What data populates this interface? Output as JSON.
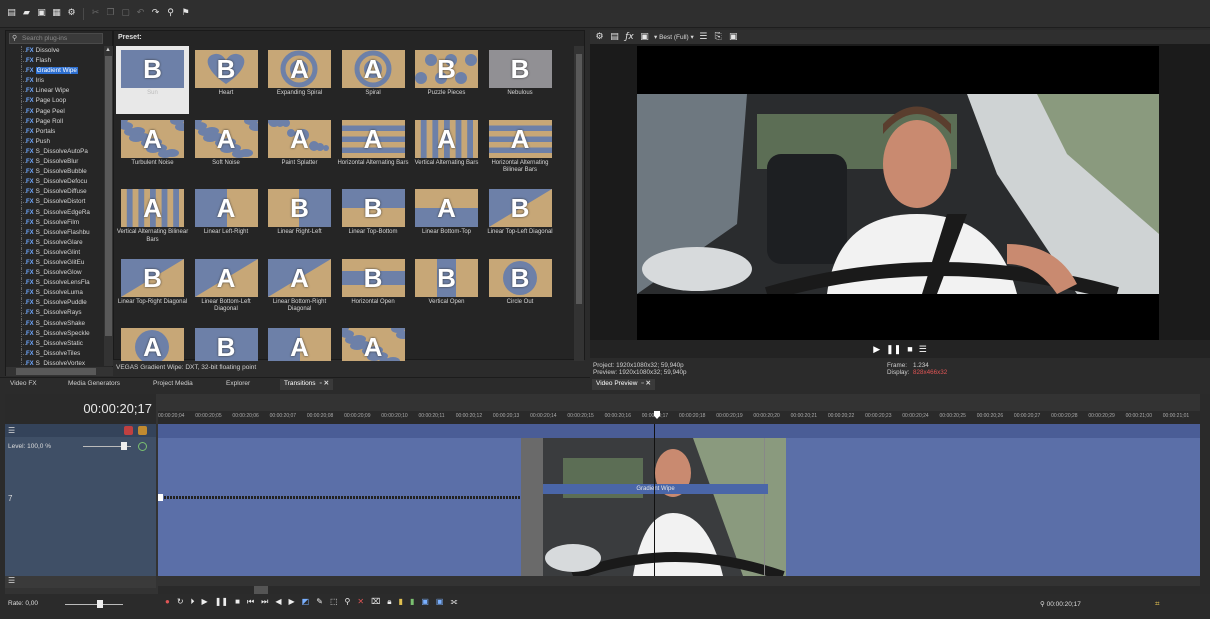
{
  "toolbar": {
    "icons": [
      "new-icon",
      "open-icon",
      "save-icon",
      "properties-icon",
      "settings-icon",
      "cut-icon",
      "copy-icon",
      "paste-icon",
      "undo-icon",
      "redo-icon",
      "snap-icon",
      "autoripple-icon"
    ]
  },
  "plugins": {
    "search_placeholder": "Search plug-ins",
    "fx_prefix": "FX",
    "items": [
      "Dissolve",
      "Flash",
      "Gradient Wipe",
      "Iris",
      "Linear Wipe",
      "Page Loop",
      "Page Peel",
      "Page Roll",
      "Portals",
      "Push",
      "S_DissolveAutoPa",
      "S_DissolveBlur",
      "S_DissolveBubble",
      "S_DissolveDefocu",
      "S_DissolveDiffuse",
      "S_DissolveDistort",
      "S_DissolveEdgeRa",
      "S_DissolveFilm",
      "S_DissolveFlashbu",
      "S_DissolveGlare",
      "S_DissolveGlint",
      "S_DissolveGlitEu",
      "S_DissolveGlow",
      "S_DissolveLensFla",
      "S_DissolveLuma",
      "S_DissolvePuddle",
      "S_DissolveRays",
      "S_DissolveShake",
      "S_DissolveSpeckle",
      "S_DissolveStatic",
      "S_DissolveTiles",
      "S_DissolveVortex"
    ],
    "selected_index": 2
  },
  "presets": {
    "label": "Preset:",
    "items": [
      {
        "name": "Sun",
        "glyph": "B"
      },
      {
        "name": "Heart",
        "glyph": "B"
      },
      {
        "name": "Expanding Spiral",
        "glyph": "A"
      },
      {
        "name": "Spiral",
        "glyph": "A"
      },
      {
        "name": "Puzzle Pieces",
        "glyph": "B"
      },
      {
        "name": "Nebulous",
        "glyph": "B"
      },
      {
        "name": "Turbulent Noise",
        "glyph": "A"
      },
      {
        "name": "Soft Noise",
        "glyph": "A"
      },
      {
        "name": "Paint Splatter",
        "glyph": "A"
      },
      {
        "name": "Horizontal Alternating Bars",
        "glyph": "A"
      },
      {
        "name": "Vertical Alternating Bars",
        "glyph": "A"
      },
      {
        "name": "Horizontal Alternating Bilinear Bars",
        "glyph": "A"
      },
      {
        "name": "Vertical Alternating Bilinear Bars",
        "glyph": "A"
      },
      {
        "name": "Linear Left-Right",
        "glyph": "A"
      },
      {
        "name": "Linear Right-Left",
        "glyph": "B"
      },
      {
        "name": "Linear Top-Bottom",
        "glyph": "B"
      },
      {
        "name": "Linear Bottom-Top",
        "glyph": "A"
      },
      {
        "name": "Linear Top-Left Diagonal",
        "glyph": "B"
      },
      {
        "name": "Linear Top-Right Diagonal",
        "glyph": "B"
      },
      {
        "name": "Linear Bottom-Left Diagonal",
        "glyph": "A"
      },
      {
        "name": "Linear Bottom-Right Diagonal",
        "glyph": "A"
      },
      {
        "name": "Horizontal Open",
        "glyph": "B"
      },
      {
        "name": "Vertical Open",
        "glyph": "B"
      },
      {
        "name": "Circle Out",
        "glyph": "B"
      },
      {
        "name": "",
        "glyph": "A"
      },
      {
        "name": "",
        "glyph": "B"
      },
      {
        "name": "",
        "glyph": "A"
      },
      {
        "name": "",
        "glyph": "A"
      }
    ],
    "selected_index": 0
  },
  "status": "VEGAS Gradient Wipe: DXT, 32-bit floating point",
  "tabs": [
    {
      "label": "Video FX"
    },
    {
      "label": "Media Generators"
    },
    {
      "label": "Project Media"
    },
    {
      "label": "Explorer"
    },
    {
      "label": "Transitions"
    }
  ],
  "preview": {
    "quality": "Best (Full)",
    "project": "Project:  1920x1080x32; 59,940p",
    "preview": "Preview:  1920x1080x32; 59,940p",
    "frame_label": "Frame:",
    "frame_value": "1.234",
    "display_label": "Display:",
    "display_value": "828x466x32",
    "tab_label": "Video Preview"
  },
  "timeline": {
    "time": "00:00:20;17",
    "level": "Level: 100,0 %",
    "rate": "Rate: 0,00",
    "transition_label": "Gradient Wipe",
    "cursor_time": "00:00:20;17",
    "ruler": [
      "00:00:20;04",
      "00:00:20;05",
      "00:00:20;06",
      "00:00:20;07",
      "00:00:20;08",
      "00:00:20;09",
      "00:00:20;10",
      "00:00:20;11",
      "00:00:20;12",
      "00:00:20;13",
      "00:00:20;14",
      "00:00:20;15",
      "00:00:20;16",
      "00:00:20;17",
      "00:00:20;18",
      "00:00:20;19",
      "00:00:20;20",
      "00:00:20;21",
      "00:00:20;22",
      "00:00:20;23",
      "00:00:20;24",
      "00:00:20;25",
      "00:00:20;26",
      "00:00:20;27",
      "00:00:20;28",
      "00:00:20;29",
      "00:00:21;00",
      "00:00:21;01"
    ]
  },
  "colors": {
    "accent": "#2d6fd0",
    "track": "#5b6fa8",
    "thumb_tan": "#c7a777",
    "thumb_blue": "#6d80a8"
  }
}
